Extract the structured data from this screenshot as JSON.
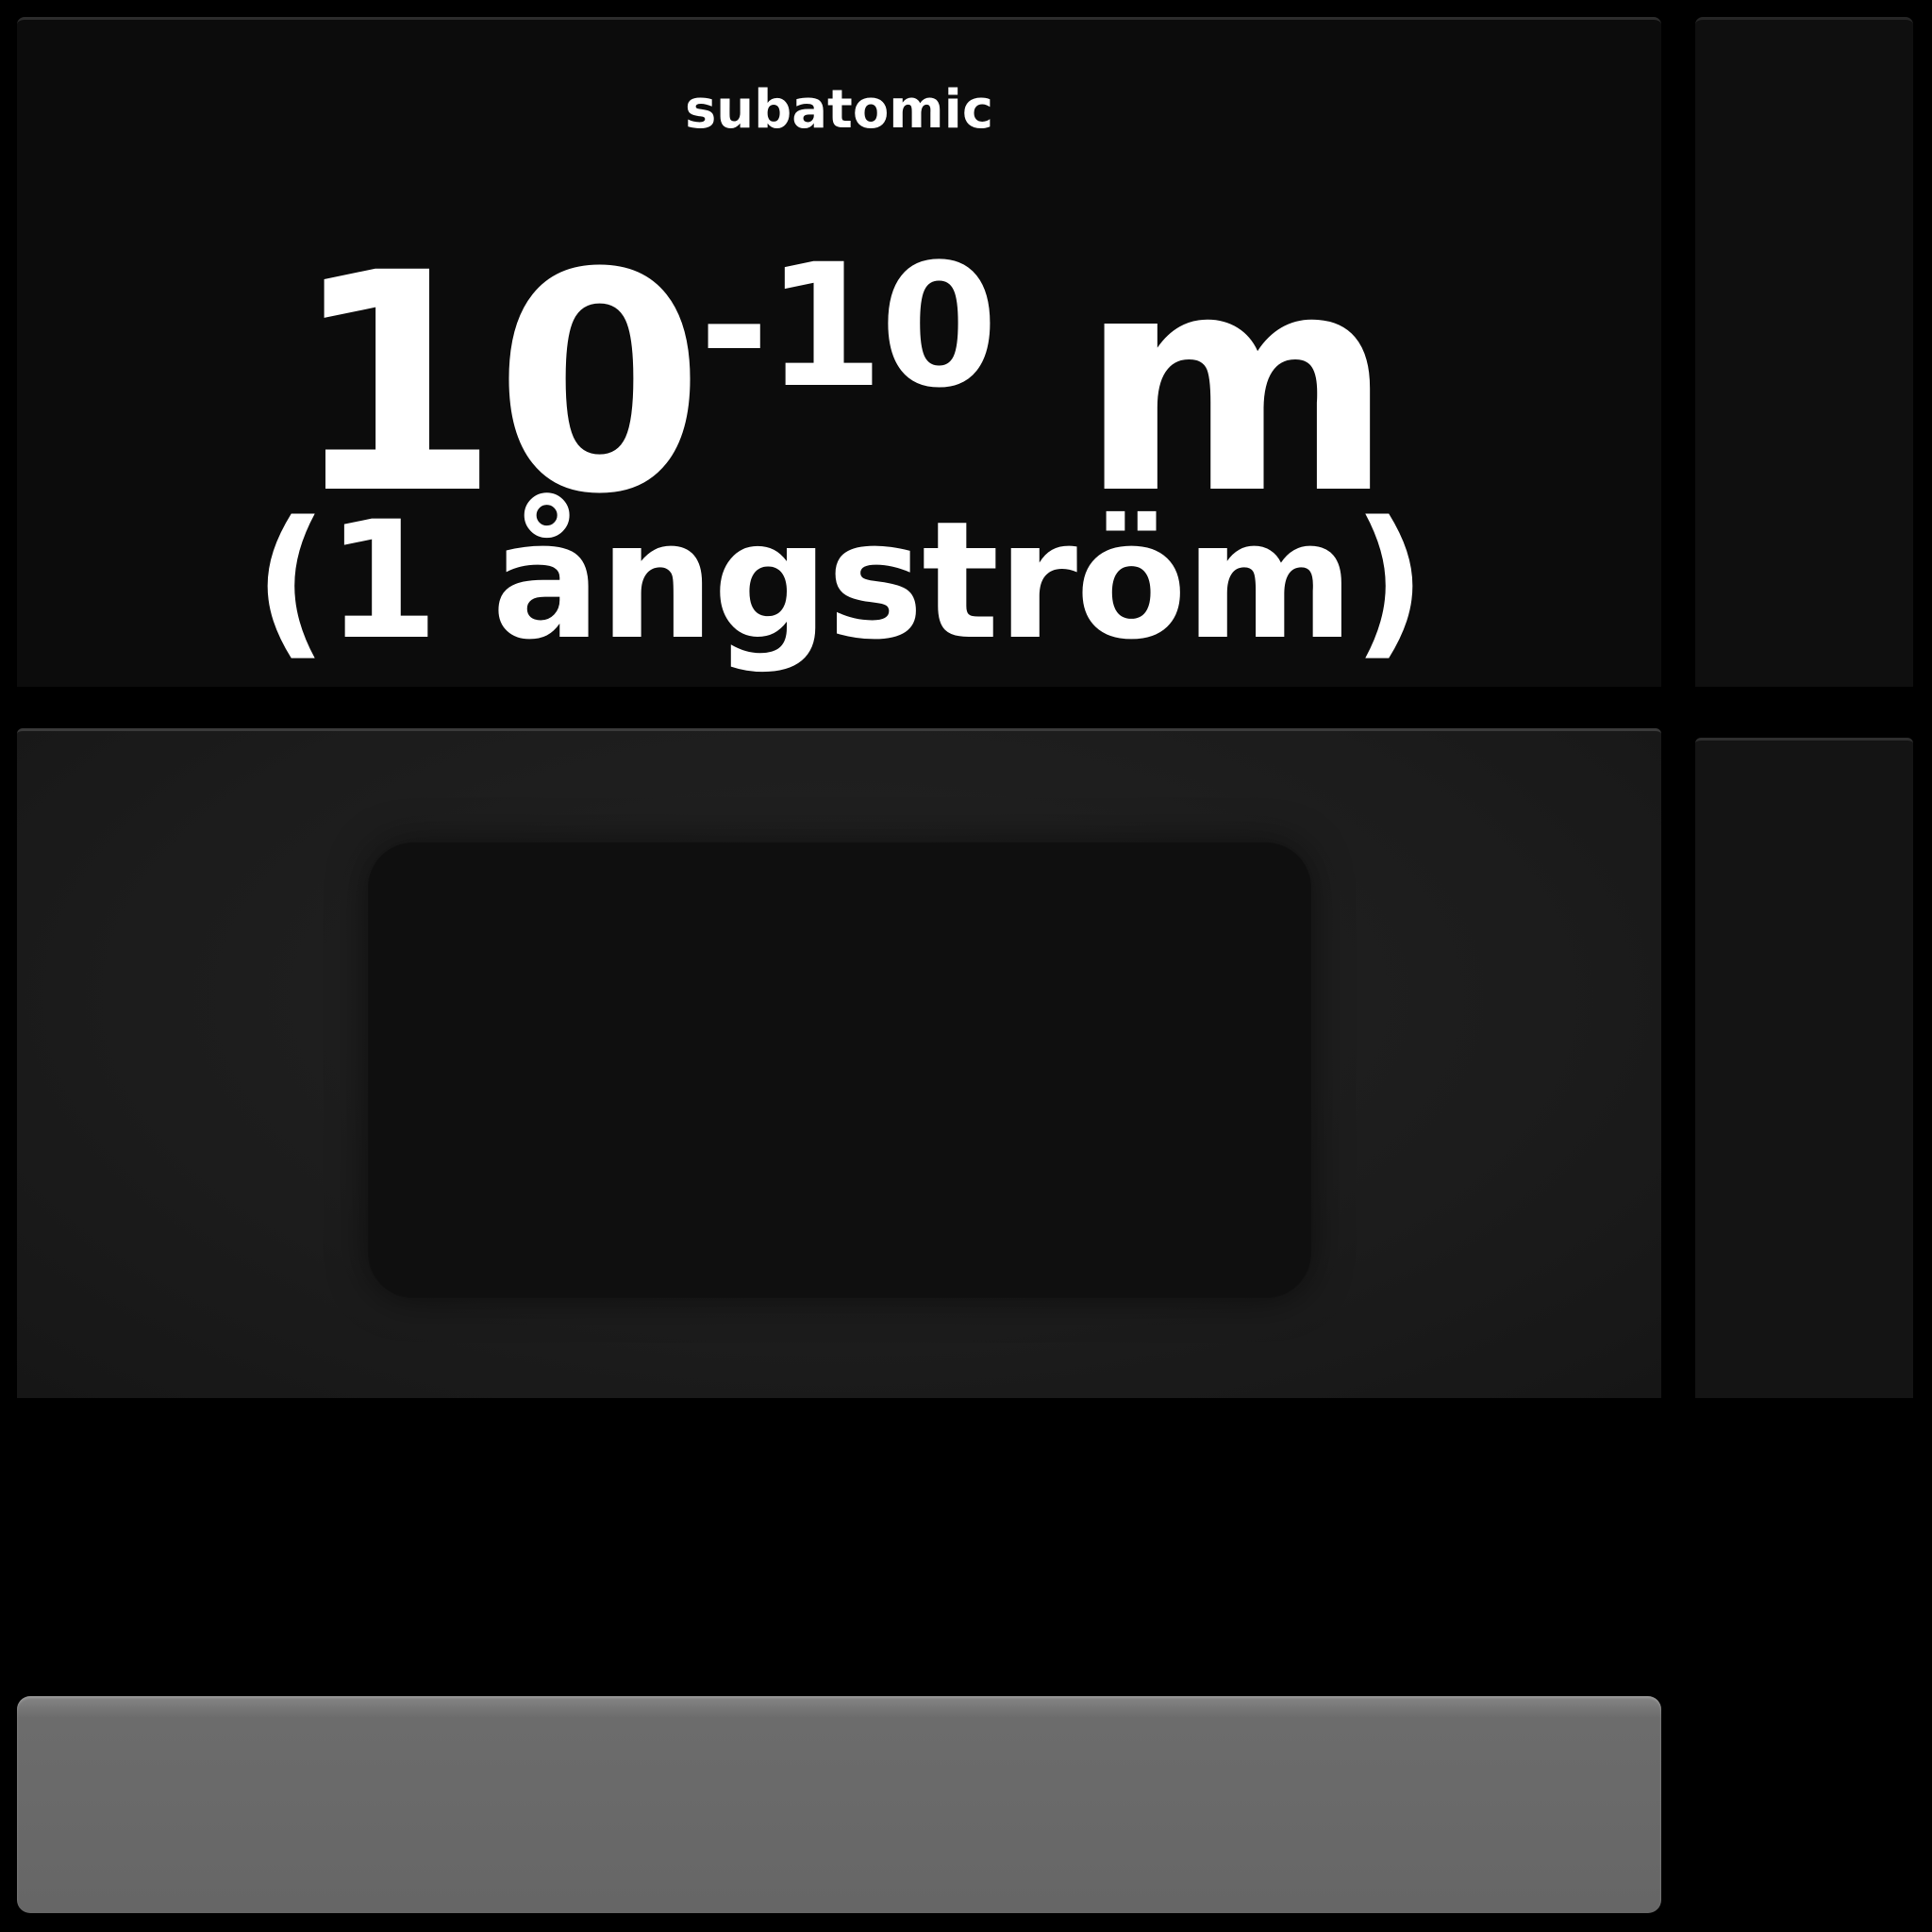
{
  "display": {
    "category": "subatomic",
    "scale_base": "10",
    "scale_exponent": "-10",
    "scale_unit": "m",
    "named_unit": "(1 ångström)"
  },
  "colors": {
    "background": "#000000",
    "display_panel": "#0c0c0c",
    "image_panel": "#1c1c1c",
    "image_screen": "#0f0f0f",
    "slider_bar": "#666666",
    "text": "#ffffff"
  }
}
